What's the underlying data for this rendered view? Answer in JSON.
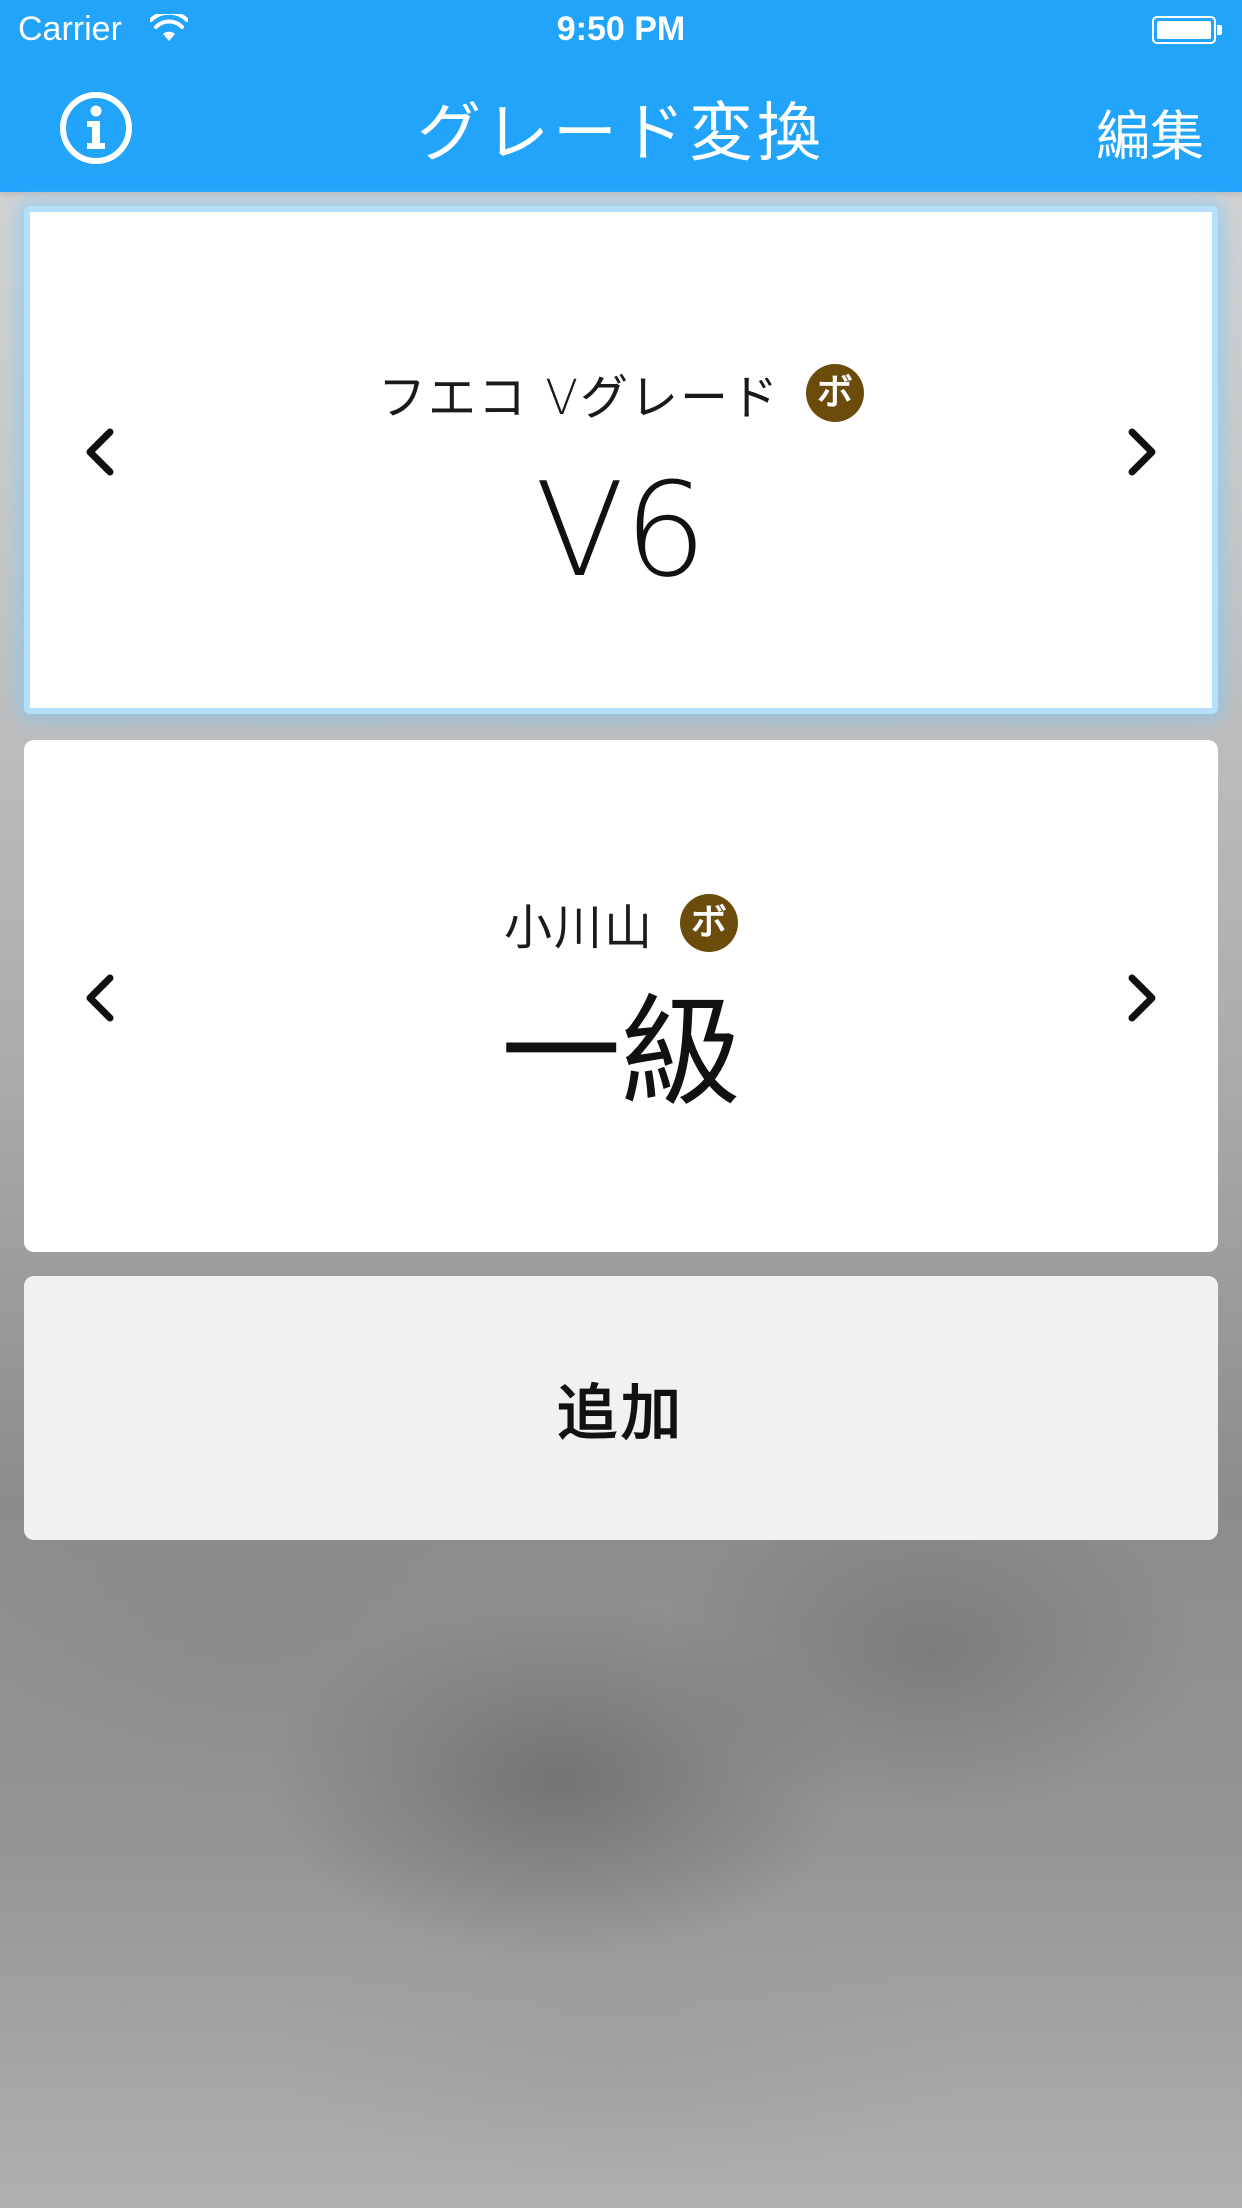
{
  "status_bar": {
    "carrier": "Carrier",
    "time": "9:50 PM",
    "wifi_icon": "wifi-icon",
    "battery_icon": "battery-full-icon"
  },
  "nav_bar": {
    "title": "グレード変換",
    "info_icon": "info-circle-icon",
    "edit_label": "編集",
    "background_color": "#22a4fb"
  },
  "cards": [
    {
      "system_name": "フエコ Vグレード",
      "type_badge": "ボ",
      "grade": "V6",
      "selected": true
    },
    {
      "system_name": "小川山",
      "type_badge": "ボ",
      "grade": "一級",
      "selected": false
    }
  ],
  "add_button": {
    "label": "追加"
  },
  "colors": {
    "badge": "#6b4c0b",
    "selected_border": "#b5e0fb"
  }
}
